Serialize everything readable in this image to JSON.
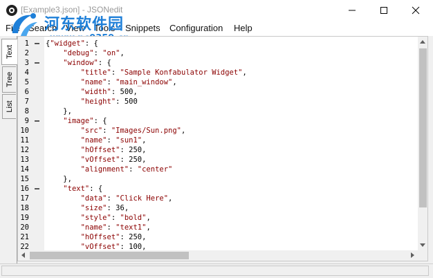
{
  "window": {
    "title": "[Example3.json] - JSONedit",
    "minimize_icon": "minimize-icon",
    "maximize_icon": "maximize-icon",
    "close_icon": "close-icon"
  },
  "watermark": {
    "line1": "河东软件园",
    "line2": "www.pc0359.cn"
  },
  "menu": [
    "File",
    "Search",
    "View",
    "Tools",
    "Snippets",
    "Configuration",
    "Help"
  ],
  "tabs": [
    "Text",
    "Tree",
    "List"
  ],
  "active_tab": "Text",
  "editor": {
    "lines": [
      {
        "n": "1",
        "indent": 0,
        "fold": true,
        "tokens": [
          [
            "p",
            "{"
          ],
          [
            "s",
            "\"widget\""
          ],
          [
            "p",
            ": {"
          ]
        ]
      },
      {
        "n": "2",
        "indent": 1,
        "fold": false,
        "tokens": [
          [
            "s",
            "\"debug\""
          ],
          [
            "p",
            ": "
          ],
          [
            "s",
            "\"on\""
          ],
          [
            "p",
            ","
          ]
        ]
      },
      {
        "n": "3",
        "indent": 1,
        "fold": true,
        "tokens": [
          [
            "s",
            "\"window\""
          ],
          [
            "p",
            ": {"
          ]
        ]
      },
      {
        "n": "4",
        "indent": 2,
        "fold": false,
        "tokens": [
          [
            "s",
            "\"title\""
          ],
          [
            "p",
            ": "
          ],
          [
            "s",
            "\"Sample Konfabulator Widget\""
          ],
          [
            "p",
            ","
          ]
        ]
      },
      {
        "n": "5",
        "indent": 2,
        "fold": false,
        "tokens": [
          [
            "s",
            "\"name\""
          ],
          [
            "p",
            ": "
          ],
          [
            "s",
            "\"main_window\""
          ],
          [
            "p",
            ","
          ]
        ]
      },
      {
        "n": "6",
        "indent": 2,
        "fold": false,
        "tokens": [
          [
            "s",
            "\"width\""
          ],
          [
            "p",
            ": "
          ],
          [
            "n",
            "500"
          ],
          [
            "p",
            ","
          ]
        ]
      },
      {
        "n": "7",
        "indent": 2,
        "fold": false,
        "tokens": [
          [
            "s",
            "\"height\""
          ],
          [
            "p",
            ": "
          ],
          [
            "n",
            "500"
          ]
        ]
      },
      {
        "n": "8",
        "indent": 1,
        "fold": false,
        "tokens": [
          [
            "p",
            "},"
          ]
        ]
      },
      {
        "n": "9",
        "indent": 1,
        "fold": true,
        "tokens": [
          [
            "s",
            "\"image\""
          ],
          [
            "p",
            ": {"
          ]
        ]
      },
      {
        "n": "10",
        "indent": 2,
        "fold": false,
        "tokens": [
          [
            "s",
            "\"src\""
          ],
          [
            "p",
            ": "
          ],
          [
            "s",
            "\"Images/Sun.png\""
          ],
          [
            "p",
            ","
          ]
        ]
      },
      {
        "n": "11",
        "indent": 2,
        "fold": false,
        "tokens": [
          [
            "s",
            "\"name\""
          ],
          [
            "p",
            ": "
          ],
          [
            "s",
            "\"sun1\""
          ],
          [
            "p",
            ","
          ]
        ]
      },
      {
        "n": "12",
        "indent": 2,
        "fold": false,
        "tokens": [
          [
            "s",
            "\"hOffset\""
          ],
          [
            "p",
            ": "
          ],
          [
            "n",
            "250"
          ],
          [
            "p",
            ","
          ]
        ]
      },
      {
        "n": "13",
        "indent": 2,
        "fold": false,
        "tokens": [
          [
            "s",
            "\"vOffset\""
          ],
          [
            "p",
            ": "
          ],
          [
            "n",
            "250"
          ],
          [
            "p",
            ","
          ]
        ]
      },
      {
        "n": "14",
        "indent": 2,
        "fold": false,
        "tokens": [
          [
            "s",
            "\"alignment\""
          ],
          [
            "p",
            ": "
          ],
          [
            "s",
            "\"center\""
          ]
        ]
      },
      {
        "n": "15",
        "indent": 1,
        "fold": false,
        "tokens": [
          [
            "p",
            "},"
          ]
        ]
      },
      {
        "n": "16",
        "indent": 1,
        "fold": true,
        "tokens": [
          [
            "s",
            "\"text\""
          ],
          [
            "p",
            ": {"
          ]
        ]
      },
      {
        "n": "17",
        "indent": 2,
        "fold": false,
        "tokens": [
          [
            "s",
            "\"data\""
          ],
          [
            "p",
            ": "
          ],
          [
            "s",
            "\"Click Here\""
          ],
          [
            "p",
            ","
          ]
        ]
      },
      {
        "n": "18",
        "indent": 2,
        "fold": false,
        "tokens": [
          [
            "s",
            "\"size\""
          ],
          [
            "p",
            ": "
          ],
          [
            "n",
            "36"
          ],
          [
            "p",
            ","
          ]
        ]
      },
      {
        "n": "19",
        "indent": 2,
        "fold": false,
        "tokens": [
          [
            "s",
            "\"style\""
          ],
          [
            "p",
            ": "
          ],
          [
            "s",
            "\"bold\""
          ],
          [
            "p",
            ","
          ]
        ]
      },
      {
        "n": "20",
        "indent": 2,
        "fold": false,
        "tokens": [
          [
            "s",
            "\"name\""
          ],
          [
            "p",
            ": "
          ],
          [
            "s",
            "\"text1\""
          ],
          [
            "p",
            ","
          ]
        ]
      },
      {
        "n": "21",
        "indent": 2,
        "fold": false,
        "tokens": [
          [
            "s",
            "\"hOffset\""
          ],
          [
            "p",
            ": "
          ],
          [
            "n",
            "250"
          ],
          [
            "p",
            ","
          ]
        ]
      },
      {
        "n": "22",
        "indent": 2,
        "fold": false,
        "tokens": [
          [
            "s",
            "\"vOffset\""
          ],
          [
            "p",
            ": "
          ],
          [
            "n",
            "100"
          ],
          [
            "p",
            ","
          ]
        ]
      }
    ]
  },
  "colors": {
    "string": "#8b0000",
    "watermark": "#1e7fd8"
  }
}
